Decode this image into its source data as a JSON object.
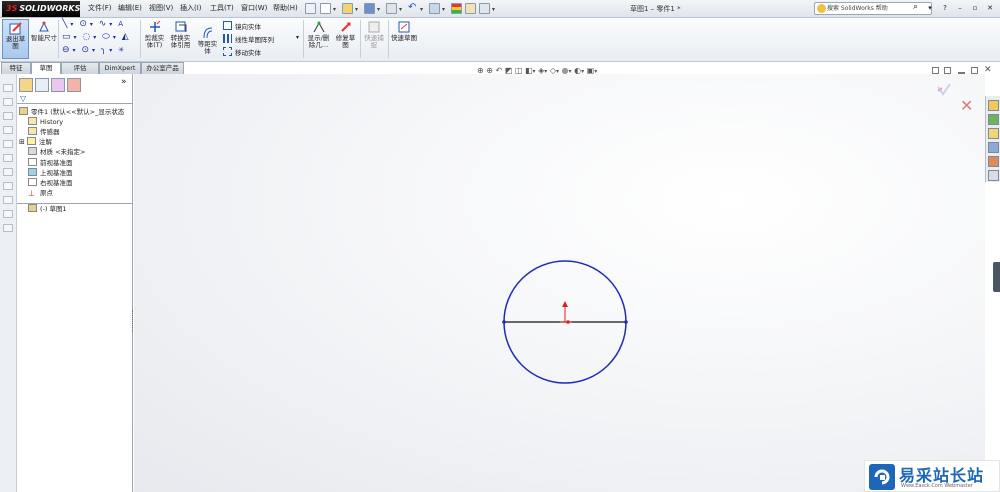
{
  "app": {
    "logo_text": "SOLIDWORKS",
    "logo_mark": "3S",
    "doc_title": "草图1 – 零件1 *"
  },
  "menu": [
    "文件(F)",
    "编辑(E)",
    "视图(V)",
    "插入(I)",
    "工具(T)",
    "窗口(W)",
    "帮助(H)"
  ],
  "search": {
    "placeholder": "搜索 SolidWorks 帮助"
  },
  "window_controls": [
    "?",
    "–",
    "▫",
    "✕"
  ],
  "ribbon": {
    "exit_sketch": "退出草图",
    "smart_dimension": "智能尺寸",
    "trim": "剪裁实体(T)",
    "convert": "转换实体引用",
    "offset": "等距实体",
    "mirror": "镜向实体",
    "linear_pattern": "线性草图阵列",
    "move": "移动实体",
    "display_delete": "显示/删除几…",
    "repair": "修复草图",
    "rapid": "快速捕捉",
    "rapid_sketch": "快速草图"
  },
  "tabs": [
    "特征",
    "草图",
    "评估",
    "DimXpert",
    "办公室产品"
  ],
  "active_tab": 1,
  "tree": {
    "root": "零件1 (默认<<默认>_显示状态",
    "items": [
      "History",
      "传感器",
      "注解",
      "材质 <未指定>",
      "前视基准面",
      "上视基准面",
      "右视基准面",
      "原点",
      "(-) 草图1"
    ]
  },
  "sketch": {
    "circle_color": "#1f2bb5",
    "line_color": "#111111",
    "origin_color": "#e02020"
  },
  "watermark": {
    "title": "易采站长站",
    "subtitle": "Www.Easck.Com  Webmaster"
  }
}
